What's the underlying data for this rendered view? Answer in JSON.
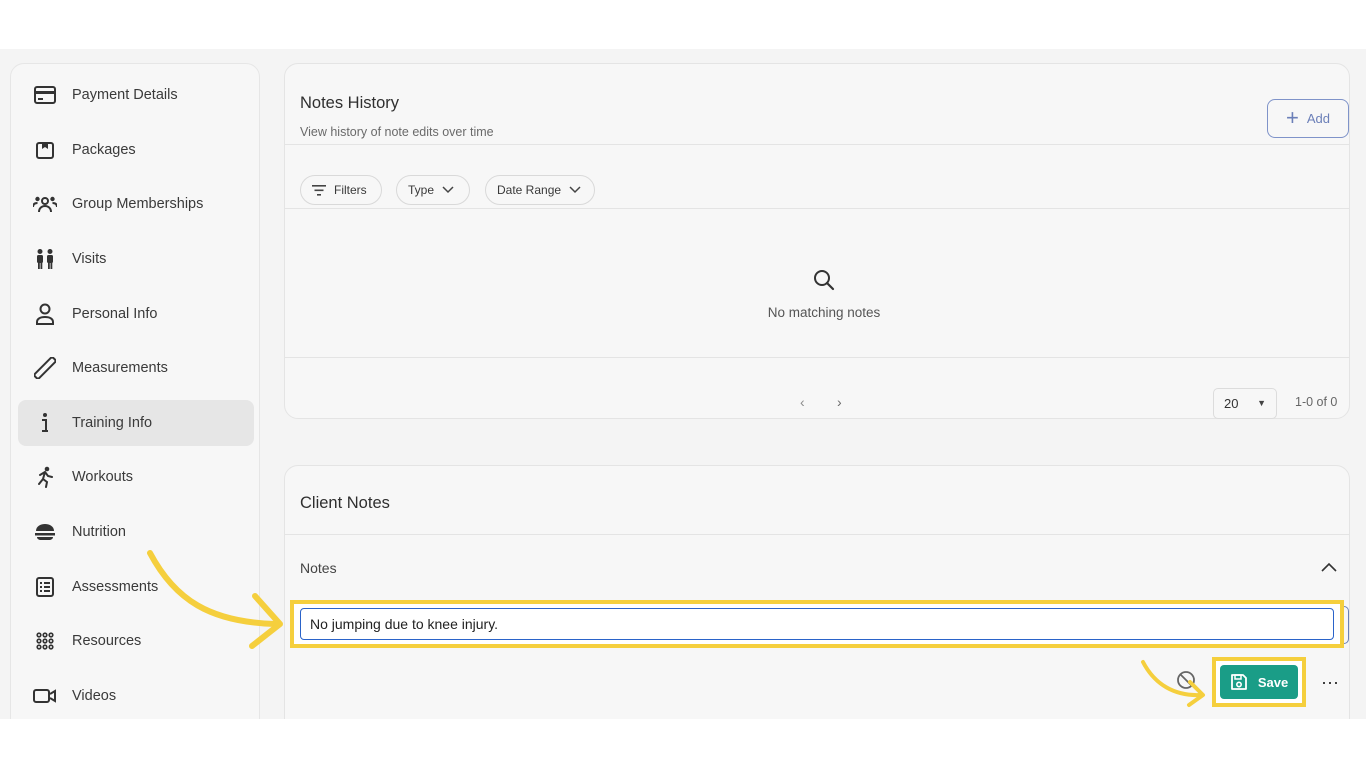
{
  "sidebar": {
    "items": [
      {
        "label": "Payment Details",
        "icon": "credit-card-icon"
      },
      {
        "label": "Packages",
        "icon": "package-icon"
      },
      {
        "label": "Group Memberships",
        "icon": "group-icon"
      },
      {
        "label": "Visits",
        "icon": "visits-icon"
      },
      {
        "label": "Personal Info",
        "icon": "person-icon"
      },
      {
        "label": "Measurements",
        "icon": "ruler-icon"
      },
      {
        "label": "Training Info",
        "icon": "info-icon",
        "active": true
      },
      {
        "label": "Workouts",
        "icon": "running-icon"
      },
      {
        "label": "Nutrition",
        "icon": "nutrition-icon"
      },
      {
        "label": "Assessments",
        "icon": "assessment-icon"
      },
      {
        "label": "Resources",
        "icon": "grid-icon"
      },
      {
        "label": "Videos",
        "icon": "video-icon"
      }
    ]
  },
  "notes_history": {
    "title": "Notes History",
    "subtitle": "View history of note edits over time",
    "add_label": "Add",
    "filters": {
      "filters_label": "Filters",
      "type_label": "Type",
      "date_range_label": "Date Range"
    },
    "empty_text": "No matching notes",
    "pagination": {
      "per_page": "20",
      "range_text": "1-0 of 0"
    }
  },
  "client_notes": {
    "title": "Client Notes",
    "notes_label": "Notes",
    "note_value": "No jumping due to knee injury.",
    "save_label": "Save"
  },
  "colors": {
    "save_button": "#1a9d87",
    "highlight": "#f5cf3d",
    "add_button_accent": "#7f93c9"
  }
}
